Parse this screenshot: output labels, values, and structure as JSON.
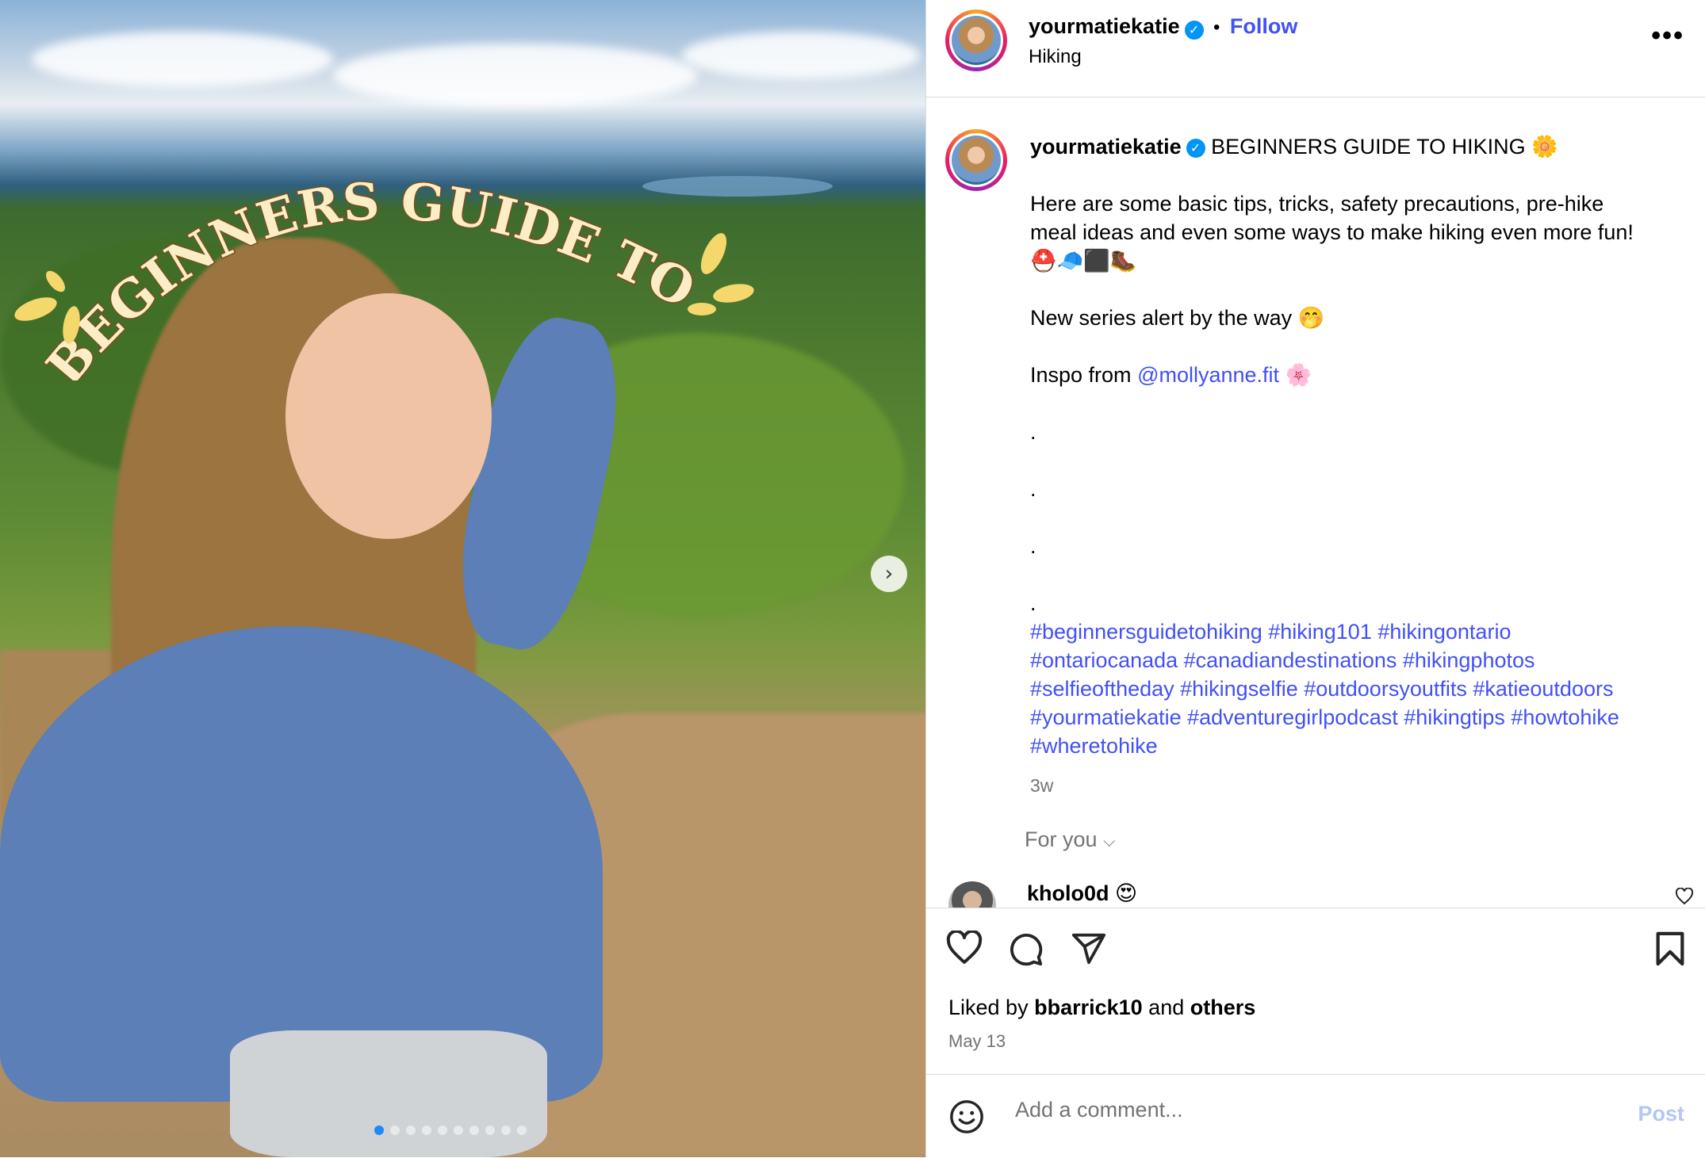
{
  "post": {
    "headline": "BEGINNERS GUIDE TO HIKING"
  },
  "header": {
    "username": "yourmatiekatie",
    "separator": "•",
    "follow_label": "Follow",
    "subtitle": "Hiking",
    "more_icon": "more-horizontal-icon"
  },
  "caption": {
    "username": "yourmatiekatie",
    "title": "BEGINNERS GUIDE TO HIKING",
    "title_emoji": "🌼",
    "body_line1": "Here are some basic tips, tricks, safety precautions, pre-hike",
    "body_line2": "meal ideas and even some ways to make hiking even more fun!",
    "emoji_line": "⛑️🧢⬛🥾",
    "series_text": "New series alert by the way",
    "series_emoji": "🤭",
    "inspo_prefix": "Inspo from ",
    "inspo_mention": "@mollyanne.fit",
    "inspo_emoji": "🌸",
    "dot": ".",
    "hashtags_line1": "#beginnersguidetohiking #hiking101 #hikingontario",
    "hashtags_line2": "#ontariocanada #canadiandestinations #hikingphotos",
    "hashtags_line3": "#selfieoftheday #hikingselfie #outdoorsyoutfits #katieoutdoors",
    "hashtags_line4": "#yourmatiekatie #adventuregirlpodcast #hikingtips #howtohike",
    "hashtags_line5": "#wheretohike",
    "timestamp": "3w"
  },
  "comments": {
    "for_you_label": "For you",
    "first_comment_user": "kholo0d",
    "first_comment_emoji": "😍"
  },
  "actions": {
    "liked_prefix": "Liked by ",
    "liked_user": "bbarrick10",
    "liked_and": " and ",
    "liked_others": "others",
    "date": "May 13"
  },
  "comment_bar": {
    "placeholder": "Add a comment...",
    "post_label": "Post"
  },
  "carousel": {
    "total": 10,
    "active_index": 0
  },
  "colors": {
    "link": "#4150f7",
    "verified": "#0095f6",
    "muted": "#737373",
    "post_disabled": "#b3c6f7"
  }
}
